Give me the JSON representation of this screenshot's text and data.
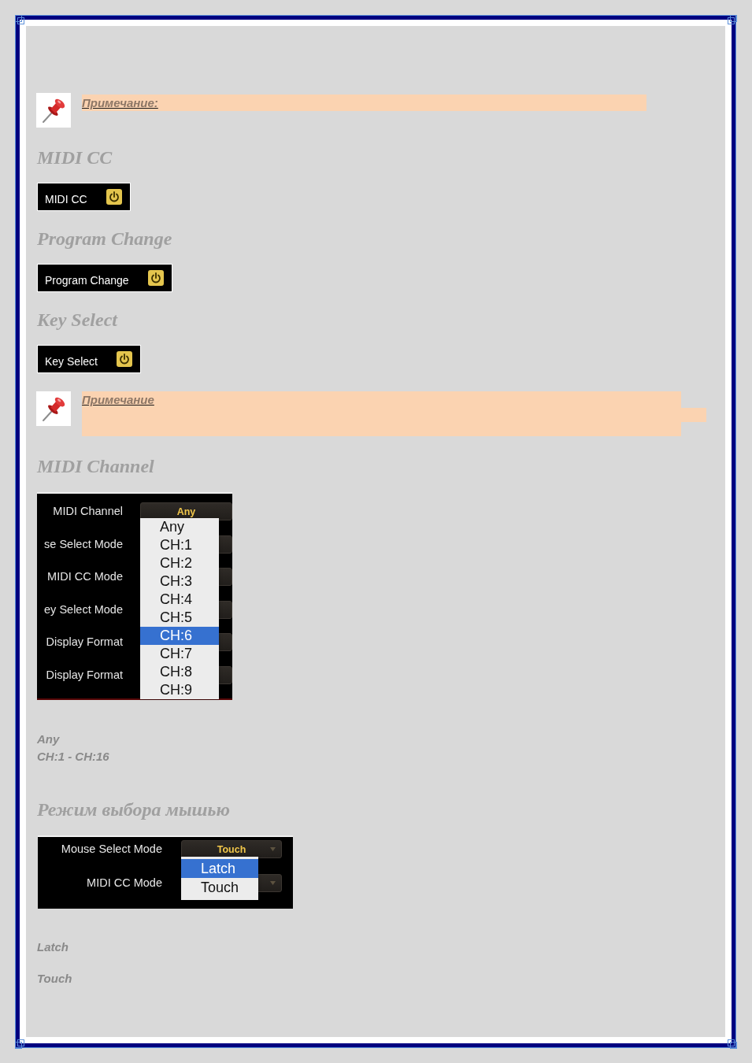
{
  "page": {
    "blocks": [
      {
        "kind": "note_line",
        "label": "Примечание:"
      },
      {
        "kind": "heading",
        "text": "MIDI CC"
      },
      {
        "kind": "toggle_button",
        "label": "MIDI CC"
      },
      {
        "kind": "heading",
        "text": "Program Change"
      },
      {
        "kind": "toggle_button",
        "label": "Program Change"
      },
      {
        "kind": "heading",
        "text": "Key Select"
      },
      {
        "kind": "toggle_button",
        "label": "Key Select"
      },
      {
        "kind": "note_block",
        "label": "Примечание"
      },
      {
        "kind": "heading",
        "text": "MIDI Channel"
      },
      {
        "kind": "channel_panel",
        "rows": [
          {
            "label": "MIDI Channel",
            "value": "Any"
          },
          {
            "label": "se Select Mode"
          },
          {
            "label": "MIDI CC Mode"
          },
          {
            "label": "ey Select Mode"
          },
          {
            "label": "Display Format"
          },
          {
            "label": "Display Format"
          }
        ],
        "menu": [
          {
            "label": "Any",
            "selected": false
          },
          {
            "label": "CH:1",
            "selected": false
          },
          {
            "label": "CH:2",
            "selected": false
          },
          {
            "label": "CH:3",
            "selected": false
          },
          {
            "label": "CH:4",
            "selected": false
          },
          {
            "label": "CH:5",
            "selected": false
          },
          {
            "label": "CH:6",
            "selected": true
          },
          {
            "label": "CH:7",
            "selected": false
          },
          {
            "label": "CH:8",
            "selected": false
          },
          {
            "label": "CH:9",
            "selected": false
          }
        ]
      },
      {
        "kind": "text_lines",
        "lines": [
          "Any",
          "CH:1 - CH:16"
        ]
      },
      {
        "kind": "heading",
        "text": "Режим выбора мышью"
      },
      {
        "kind": "mode_panel",
        "rows": [
          {
            "label": "Mouse Select Mode",
            "value": "Touch"
          },
          {
            "label": "MIDI CC Mode"
          }
        ],
        "menu": [
          {
            "label": "Latch",
            "selected": true
          },
          {
            "label": "Touch",
            "selected": false
          }
        ]
      },
      {
        "kind": "text_line",
        "text": "Latch"
      },
      {
        "kind": "text_line",
        "text": "Touch"
      }
    ]
  }
}
